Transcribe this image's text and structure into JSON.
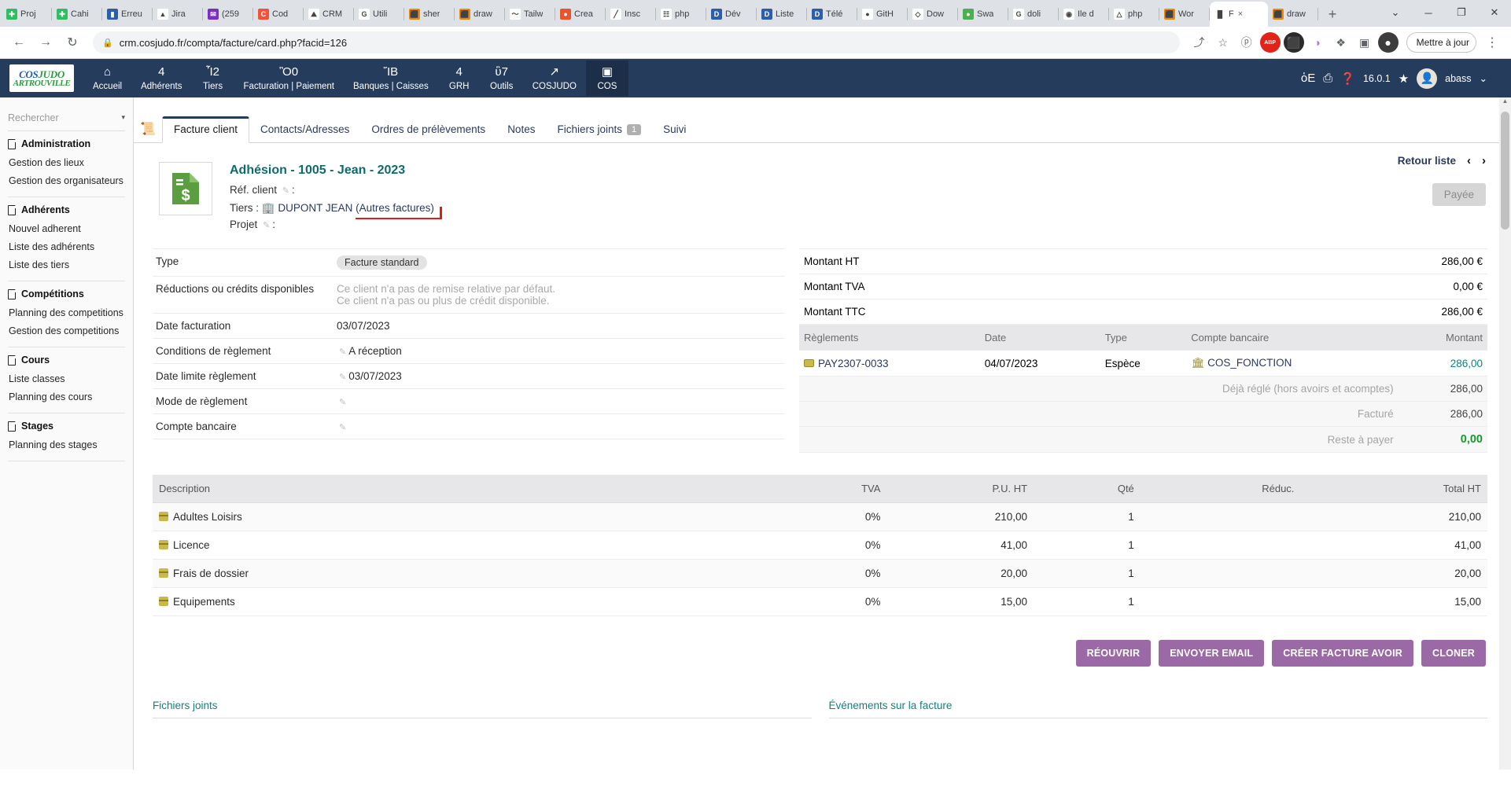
{
  "browser": {
    "tabs": [
      {
        "label": "Proj",
        "icon": "evernote-icon",
        "color": "#2dbe60",
        "glyph": "✚"
      },
      {
        "label": "Cahi",
        "icon": "evernote-icon",
        "color": "#2dbe60",
        "glyph": "✚"
      },
      {
        "label": "Erreu",
        "icon": "intellij-icon",
        "color": "#2b5fa8",
        "glyph": "▮"
      },
      {
        "label": "Jira",
        "icon": "jira-icon",
        "color": "#ffffff",
        "glyph": "▲"
      },
      {
        "label": "(259",
        "icon": "mail-icon",
        "color": "#7b2fbe",
        "glyph": "✉"
      },
      {
        "label": "Cod",
        "icon": "codepen-icon",
        "color": "#f0533a",
        "glyph": "C"
      },
      {
        "label": "CRM",
        "icon": "crm-icon",
        "color": "#ffffff",
        "glyph": "⛰"
      },
      {
        "label": "Utili",
        "icon": "google-icon",
        "color": "#ffffff",
        "glyph": "G"
      },
      {
        "label": "sher",
        "icon": "drawio-icon",
        "color": "#f08705",
        "glyph": "⬛"
      },
      {
        "label": "draw",
        "icon": "drawio-icon",
        "color": "#f08705",
        "glyph": "⬛"
      },
      {
        "label": "Tailw",
        "icon": "tailwind-icon",
        "color": "#ffffff",
        "glyph": "〜"
      },
      {
        "label": "Crea",
        "icon": "opera-icon",
        "color": "#e8542f",
        "glyph": "●"
      },
      {
        "label": "Insc",
        "icon": "pen-icon",
        "color": "#ffffff",
        "glyph": "╱"
      },
      {
        "label": "php",
        "icon": "phpmyadmin-icon",
        "color": "#ffffff",
        "glyph": "☷"
      },
      {
        "label": "Dév",
        "icon": "dolibarr-icon",
        "color": "#2b5fa8",
        "glyph": "D"
      },
      {
        "label": "Liste",
        "icon": "dolibarr-icon",
        "color": "#2b5fa8",
        "glyph": "D"
      },
      {
        "label": "Télé",
        "icon": "dolibarr-icon",
        "color": "#2b5fa8",
        "glyph": "D"
      },
      {
        "label": "GitH",
        "icon": "github-icon",
        "color": "#ffffff",
        "glyph": "●"
      },
      {
        "label": "Dow",
        "icon": "diamond-icon",
        "color": "#ffffff",
        "glyph": "◇"
      },
      {
        "label": "Swa",
        "icon": "swagger-icon",
        "color": "#4caf50",
        "glyph": "●"
      },
      {
        "label": "doli",
        "icon": "google-icon",
        "color": "#ffffff",
        "glyph": "G"
      },
      {
        "label": "Ile d",
        "icon": "maps-icon",
        "color": "#ffffff",
        "glyph": "◉"
      },
      {
        "label": "php",
        "icon": "drive-icon",
        "color": "#ffffff",
        "glyph": "△"
      },
      {
        "label": "Wor",
        "icon": "drawio-icon",
        "color": "#f08705",
        "glyph": "⬛"
      },
      {
        "label": "F",
        "icon": "chart-icon",
        "color": "#ffffff",
        "glyph": "█",
        "active": true,
        "close": "×"
      },
      {
        "label": "draw",
        "icon": "drawio-icon",
        "color": "#f08705",
        "glyph": "⬛"
      }
    ],
    "newtab_glyph": "+",
    "window_controls": [
      "⌄",
      "─",
      "❐",
      "✕"
    ],
    "back_glyph": "←",
    "forward_glyph": "→",
    "reload_glyph": "↻",
    "lock_glyph": "ὑ2",
    "url": "crm.cosjudo.fr/compta/facture/card.php?facid=126",
    "toolbar_icons": [
      {
        "name": "share-icon",
        "glyph": "⤴"
      },
      {
        "name": "bookmark-star-icon",
        "glyph": "☆"
      },
      {
        "name": "pocket-icon",
        "glyph": "ⓟ"
      },
      {
        "name": "adblock-icon",
        "glyph": "ABP"
      },
      {
        "name": "extension-lion-icon",
        "glyph": "⬛"
      },
      {
        "name": "extension-purple-icon",
        "glyph": "◑"
      },
      {
        "name": "extensions-puzzle-icon",
        "glyph": "❖"
      },
      {
        "name": "sidepanel-icon",
        "glyph": "▣"
      },
      {
        "name": "profile-avatar-icon",
        "glyph": "●"
      }
    ],
    "update_label": "Mettre à jour",
    "update_menu_glyph": "⋮"
  },
  "appheader": {
    "logo_line1": "COS",
    "logo_line1_em": "JUDO",
    "logo_line2": "ARTROUVILLE",
    "menu": [
      {
        "label": "Accueil",
        "icon": "home-icon",
        "glyph": "⌂"
      },
      {
        "label": "Adhérents",
        "icon": "user-icon",
        "glyph": "὆4"
      },
      {
        "label": "Tiers",
        "icon": "building-icon",
        "glyph": "Ἶ2"
      },
      {
        "label": "Facturation | Paiement",
        "icon": "invoice-icon",
        "glyph": "Ὃ0"
      },
      {
        "label": "Banques | Caisses",
        "icon": "bank-icon",
        "glyph": "ἽB"
      },
      {
        "label": "GRH",
        "icon": "hr-icon",
        "glyph": "὆4"
      },
      {
        "label": "Outils",
        "icon": "wrench-icon",
        "glyph": "ὒ7"
      },
      {
        "label": "COSJUDO",
        "icon": "external-link-icon",
        "glyph": "↗"
      },
      {
        "label": "COS",
        "icon": "note-icon",
        "glyph": "▣",
        "selected": true
      }
    ],
    "right_icons": [
      {
        "name": "bug-icon",
        "glyph": "ὁE"
      },
      {
        "name": "print-icon",
        "glyph": "⎙"
      },
      {
        "name": "help-icon",
        "glyph": "❓"
      }
    ],
    "version": "16.0.1",
    "star_glyph": "★",
    "username": "abass",
    "user_caret": "⌄"
  },
  "sidebar": {
    "search_placeholder": "Rechercher",
    "search_caret": "▾",
    "groups": [
      {
        "title": "Administration",
        "items": [
          "Gestion des lieux",
          "Gestion des organisateurs"
        ]
      },
      {
        "title": "Adhérents",
        "items": [
          "Nouvel adherent",
          "Liste des adhérents",
          "Liste des tiers"
        ]
      },
      {
        "title": "Compétitions",
        "items": [
          "Planning des competitions",
          "Gestion des competitions"
        ]
      },
      {
        "title": "Cours",
        "items": [
          "Liste classes",
          "Planning des cours"
        ]
      },
      {
        "title": "Stages",
        "items": [
          "Planning des stages"
        ]
      }
    ]
  },
  "page": {
    "doc_icon": "invoice-green-icon",
    "tabs": [
      {
        "label": "Facture client",
        "active": true
      },
      {
        "label": "Contacts/Adresses"
      },
      {
        "label": "Ordres de prélèvements"
      },
      {
        "label": "Notes"
      },
      {
        "label": "Fichiers joints",
        "badge": "1"
      },
      {
        "label": "Suivi"
      }
    ],
    "title": "Adhésion - 1005 - Jean - 2023",
    "ref_client_label": "Réf. client",
    "ref_client_value": "",
    "tiers_label": "Tiers :",
    "tiers_value": "DUPONT JEAN",
    "tiers_link": "(Autres factures)",
    "projet_label": "Projet",
    "projet_value": "",
    "retour_liste": "Retour liste",
    "prev_glyph": "‹",
    "next_glyph": "›",
    "status": "Payée",
    "details": [
      {
        "label": "Type",
        "type": "chip",
        "value": "Facture standard"
      },
      {
        "label": "Réductions ou crédits disponibles",
        "type": "muted2",
        "value": "Ce client n'a pas de remise relative par défaut.",
        "value2": "Ce client n'a pas ou plus de crédit disponible."
      },
      {
        "label": "Date facturation",
        "type": "text",
        "value": "03/07/2023"
      },
      {
        "label": "Conditions de règlement",
        "type": "edit",
        "value": "A réception"
      },
      {
        "label": "Date limite règlement",
        "type": "edit",
        "value": "03/07/2023"
      },
      {
        "label": "Mode de règlement",
        "type": "edit",
        "value": ""
      },
      {
        "label": "Compte bancaire",
        "type": "edit",
        "value": ""
      }
    ],
    "amounts": [
      {
        "label": "Montant HT",
        "value": "286,00 €"
      },
      {
        "label": "Montant TVA",
        "value": "0,00 €"
      },
      {
        "label": "Montant TTC",
        "value": "286,00 €"
      }
    ],
    "payments_headers": [
      "Règlements",
      "Date",
      "Type",
      "Compte bancaire",
      "Montant"
    ],
    "payments": [
      {
        "ref": "PAY2307-0033",
        "date": "04/07/2023",
        "type": "Espèce",
        "account": "COS_FONCTION",
        "amount": "286,00"
      }
    ],
    "payment_summary": [
      {
        "label": "Déjà réglé (hors avoirs et acomptes)",
        "value": "286,00",
        "strong": false
      },
      {
        "label": "Facturé",
        "value": "286,00",
        "strong": false
      },
      {
        "label": "Reste à payer",
        "value": "0,00",
        "strong": true
      }
    ],
    "lines_headers": [
      "Description",
      "TVA",
      "P.U. HT",
      "Qté",
      "Réduc.",
      "Total HT"
    ],
    "lines": [
      {
        "description": "Adultes Loisirs",
        "tva": "0%",
        "pu": "210,00",
        "qty": "1",
        "reduc": "",
        "total": "210,00"
      },
      {
        "description": "Licence",
        "tva": "0%",
        "pu": "41,00",
        "qty": "1",
        "reduc": "",
        "total": "41,00"
      },
      {
        "description": "Frais de dossier",
        "tva": "0%",
        "pu": "20,00",
        "qty": "1",
        "reduc": "",
        "total": "20,00"
      },
      {
        "description": "Equipements",
        "tva": "0%",
        "pu": "15,00",
        "qty": "1",
        "reduc": "",
        "total": "15,00"
      }
    ],
    "buttons": [
      "RÉOUVRIR",
      "ENVOYER EMAIL",
      "CRÉER FACTURE AVOIR",
      "CLONER"
    ],
    "bottom_sections": [
      "Fichiers joints",
      "Événements sur la facture"
    ]
  },
  "colors": {
    "navbar": "#263c5c",
    "title_teal": "#106b68",
    "button_purple": "#9b6aa6",
    "link_blue": "#2b3a5c",
    "green": "#179b28",
    "annotation_red": "#e01b1b"
  }
}
